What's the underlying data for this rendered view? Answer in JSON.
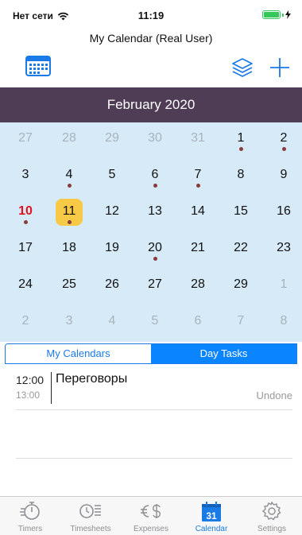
{
  "status": {
    "carrier": "Нет сети",
    "time": "11:19"
  },
  "app_title": "My Calendar (Real User)",
  "colors": {
    "accent": "#1a7ae6",
    "month_header": "#4f3d56",
    "grid_bg": "#d6eaf7",
    "today": "#f6c946",
    "holiday": "#e0141e",
    "event_dot": "#8a3c3c"
  },
  "toolbar": {
    "left_icon": "calendar-grid-icon",
    "layers_icon": "layers-icon",
    "add_icon": "plus-icon"
  },
  "month": "February 2020",
  "days": [
    {
      "n": "27",
      "other": true
    },
    {
      "n": "28",
      "other": true
    },
    {
      "n": "29",
      "other": true
    },
    {
      "n": "30",
      "other": true
    },
    {
      "n": "31",
      "other": true
    },
    {
      "n": "1",
      "dot": true
    },
    {
      "n": "2",
      "dot": true
    },
    {
      "n": "3"
    },
    {
      "n": "4",
      "dot": true
    },
    {
      "n": "5"
    },
    {
      "n": "6",
      "dot": true
    },
    {
      "n": "7",
      "dot": true
    },
    {
      "n": "8"
    },
    {
      "n": "9"
    },
    {
      "n": "10",
      "holiday": true,
      "dot": true
    },
    {
      "n": "11",
      "today": true,
      "dot": true
    },
    {
      "n": "12"
    },
    {
      "n": "13"
    },
    {
      "n": "14"
    },
    {
      "n": "15"
    },
    {
      "n": "16"
    },
    {
      "n": "17"
    },
    {
      "n": "18"
    },
    {
      "n": "19"
    },
    {
      "n": "20",
      "dot": true
    },
    {
      "n": "21"
    },
    {
      "n": "22"
    },
    {
      "n": "23"
    },
    {
      "n": "24"
    },
    {
      "n": "25"
    },
    {
      "n": "26"
    },
    {
      "n": "27"
    },
    {
      "n": "28"
    },
    {
      "n": "29"
    },
    {
      "n": "1",
      "other": true
    },
    {
      "n": "2",
      "other": true
    },
    {
      "n": "3",
      "other": true
    },
    {
      "n": "4",
      "other": true
    },
    {
      "n": "5",
      "other": true
    },
    {
      "n": "6",
      "other": true
    },
    {
      "n": "7",
      "other": true
    },
    {
      "n": "8",
      "other": true
    }
  ],
  "segments": {
    "my_calendars": "My Calendars",
    "day_tasks": "Day Tasks"
  },
  "event": {
    "start": "12:00",
    "end": "13:00",
    "title": "Переговоры",
    "status": "Undone"
  },
  "tabs": [
    {
      "label": "Timers",
      "icon": "stopwatch-icon"
    },
    {
      "label": "Timesheets",
      "icon": "timesheet-icon"
    },
    {
      "label": "Expenses",
      "icon": "expenses-icon"
    },
    {
      "label": "Calendar",
      "icon": "calendar-icon",
      "badge": "31"
    },
    {
      "label": "Settings",
      "icon": "gear-icon"
    }
  ]
}
